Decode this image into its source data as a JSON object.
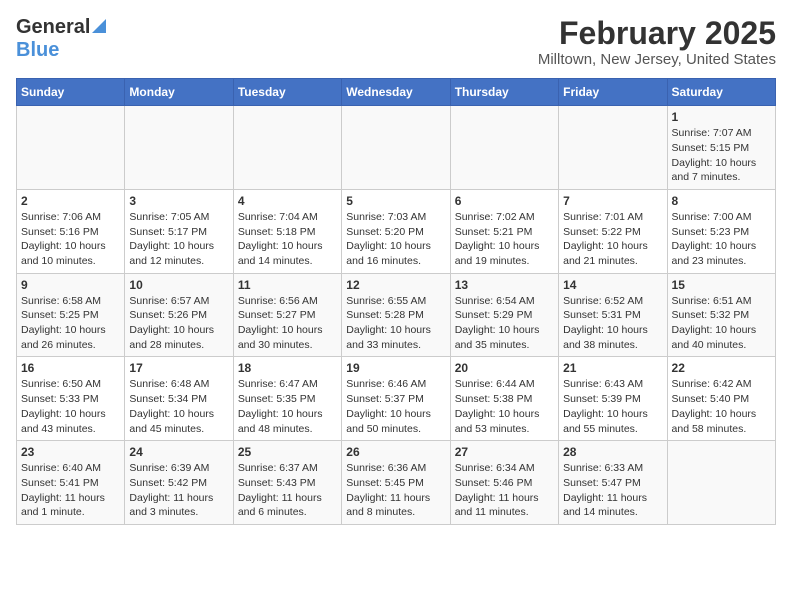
{
  "header": {
    "logo_general": "General",
    "logo_blue": "Blue",
    "title": "February 2025",
    "subtitle": "Milltown, New Jersey, United States"
  },
  "columns": [
    "Sunday",
    "Monday",
    "Tuesday",
    "Wednesday",
    "Thursday",
    "Friday",
    "Saturday"
  ],
  "weeks": [
    [
      {
        "day": "",
        "info": ""
      },
      {
        "day": "",
        "info": ""
      },
      {
        "day": "",
        "info": ""
      },
      {
        "day": "",
        "info": ""
      },
      {
        "day": "",
        "info": ""
      },
      {
        "day": "",
        "info": ""
      },
      {
        "day": "1",
        "info": "Sunrise: 7:07 AM\nSunset: 5:15 PM\nDaylight: 10 hours\nand 7 minutes."
      }
    ],
    [
      {
        "day": "2",
        "info": "Sunrise: 7:06 AM\nSunset: 5:16 PM\nDaylight: 10 hours\nand 10 minutes."
      },
      {
        "day": "3",
        "info": "Sunrise: 7:05 AM\nSunset: 5:17 PM\nDaylight: 10 hours\nand 12 minutes."
      },
      {
        "day": "4",
        "info": "Sunrise: 7:04 AM\nSunset: 5:18 PM\nDaylight: 10 hours\nand 14 minutes."
      },
      {
        "day": "5",
        "info": "Sunrise: 7:03 AM\nSunset: 5:20 PM\nDaylight: 10 hours\nand 16 minutes."
      },
      {
        "day": "6",
        "info": "Sunrise: 7:02 AM\nSunset: 5:21 PM\nDaylight: 10 hours\nand 19 minutes."
      },
      {
        "day": "7",
        "info": "Sunrise: 7:01 AM\nSunset: 5:22 PM\nDaylight: 10 hours\nand 21 minutes."
      },
      {
        "day": "8",
        "info": "Sunrise: 7:00 AM\nSunset: 5:23 PM\nDaylight: 10 hours\nand 23 minutes."
      }
    ],
    [
      {
        "day": "9",
        "info": "Sunrise: 6:58 AM\nSunset: 5:25 PM\nDaylight: 10 hours\nand 26 minutes."
      },
      {
        "day": "10",
        "info": "Sunrise: 6:57 AM\nSunset: 5:26 PM\nDaylight: 10 hours\nand 28 minutes."
      },
      {
        "day": "11",
        "info": "Sunrise: 6:56 AM\nSunset: 5:27 PM\nDaylight: 10 hours\nand 30 minutes."
      },
      {
        "day": "12",
        "info": "Sunrise: 6:55 AM\nSunset: 5:28 PM\nDaylight: 10 hours\nand 33 minutes."
      },
      {
        "day": "13",
        "info": "Sunrise: 6:54 AM\nSunset: 5:29 PM\nDaylight: 10 hours\nand 35 minutes."
      },
      {
        "day": "14",
        "info": "Sunrise: 6:52 AM\nSunset: 5:31 PM\nDaylight: 10 hours\nand 38 minutes."
      },
      {
        "day": "15",
        "info": "Sunrise: 6:51 AM\nSunset: 5:32 PM\nDaylight: 10 hours\nand 40 minutes."
      }
    ],
    [
      {
        "day": "16",
        "info": "Sunrise: 6:50 AM\nSunset: 5:33 PM\nDaylight: 10 hours\nand 43 minutes."
      },
      {
        "day": "17",
        "info": "Sunrise: 6:48 AM\nSunset: 5:34 PM\nDaylight: 10 hours\nand 45 minutes."
      },
      {
        "day": "18",
        "info": "Sunrise: 6:47 AM\nSunset: 5:35 PM\nDaylight: 10 hours\nand 48 minutes."
      },
      {
        "day": "19",
        "info": "Sunrise: 6:46 AM\nSunset: 5:37 PM\nDaylight: 10 hours\nand 50 minutes."
      },
      {
        "day": "20",
        "info": "Sunrise: 6:44 AM\nSunset: 5:38 PM\nDaylight: 10 hours\nand 53 minutes."
      },
      {
        "day": "21",
        "info": "Sunrise: 6:43 AM\nSunset: 5:39 PM\nDaylight: 10 hours\nand 55 minutes."
      },
      {
        "day": "22",
        "info": "Sunrise: 6:42 AM\nSunset: 5:40 PM\nDaylight: 10 hours\nand 58 minutes."
      }
    ],
    [
      {
        "day": "23",
        "info": "Sunrise: 6:40 AM\nSunset: 5:41 PM\nDaylight: 11 hours\nand 1 minute."
      },
      {
        "day": "24",
        "info": "Sunrise: 6:39 AM\nSunset: 5:42 PM\nDaylight: 11 hours\nand 3 minutes."
      },
      {
        "day": "25",
        "info": "Sunrise: 6:37 AM\nSunset: 5:43 PM\nDaylight: 11 hours\nand 6 minutes."
      },
      {
        "day": "26",
        "info": "Sunrise: 6:36 AM\nSunset: 5:45 PM\nDaylight: 11 hours\nand 8 minutes."
      },
      {
        "day": "27",
        "info": "Sunrise: 6:34 AM\nSunset: 5:46 PM\nDaylight: 11 hours\nand 11 minutes."
      },
      {
        "day": "28",
        "info": "Sunrise: 6:33 AM\nSunset: 5:47 PM\nDaylight: 11 hours\nand 14 minutes."
      },
      {
        "day": "",
        "info": ""
      }
    ]
  ]
}
